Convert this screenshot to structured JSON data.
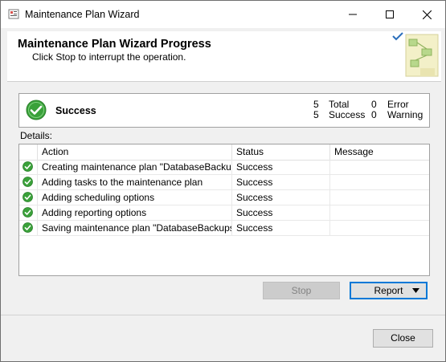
{
  "window": {
    "title": "Maintenance Plan Wizard"
  },
  "header": {
    "title": "Maintenance Plan Wizard Progress",
    "subtitle": "Click Stop to interrupt the operation."
  },
  "summary": {
    "status": "Success",
    "total_count": "5",
    "total_label": "Total",
    "success_count": "5",
    "success_label": "Success",
    "error_count": "0",
    "error_label": "Error",
    "warning_count": "0",
    "warning_label": "Warning"
  },
  "details": {
    "label": "Details:",
    "columns": [
      "Action",
      "Status",
      "Message"
    ],
    "rows": [
      {
        "action": "Creating maintenance plan \"DatabaseBackups\"",
        "status": "Success",
        "message": ""
      },
      {
        "action": "Adding tasks to the maintenance plan",
        "status": "Success",
        "message": ""
      },
      {
        "action": "Adding scheduling options",
        "status": "Success",
        "message": ""
      },
      {
        "action": "Adding reporting options",
        "status": "Success",
        "message": ""
      },
      {
        "action": "Saving maintenance plan \"DatabaseBackups\"",
        "status": "Success",
        "message": ""
      }
    ]
  },
  "buttons": {
    "stop": "Stop",
    "report": "Report",
    "close": "Close"
  },
  "colors": {
    "accent": "#0078d7",
    "success": "#3aa13a",
    "disabled_bg": "#cccccc"
  },
  "icons": {
    "row_status": "success-check-icon",
    "summary_status": "success-check-icon"
  }
}
